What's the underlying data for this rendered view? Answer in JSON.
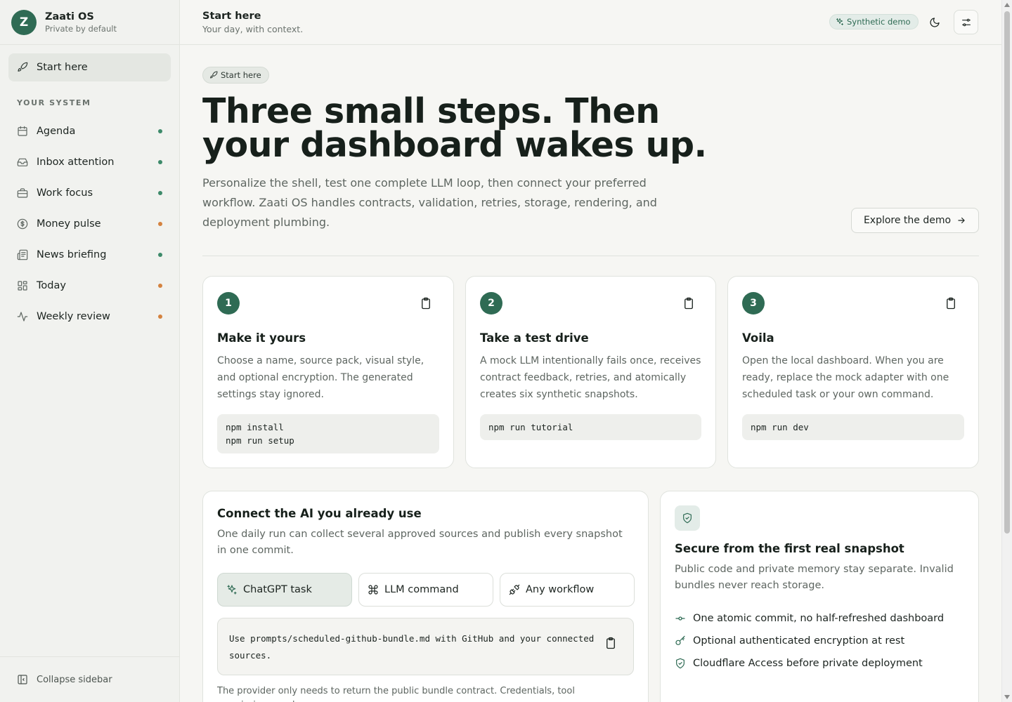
{
  "brand": {
    "initial": "Z",
    "name": "Zaati OS",
    "subtitle": "Private by default"
  },
  "sidebar": {
    "start": {
      "label": "Start here",
      "icon": "rocket-icon"
    },
    "section_label": "YOUR SYSTEM",
    "items": [
      {
        "label": "Agenda",
        "icon": "calendar-icon",
        "status_color": "#3d8a6a"
      },
      {
        "label": "Inbox attention",
        "icon": "inbox-icon",
        "status_color": "#3d8a6a"
      },
      {
        "label": "Work focus",
        "icon": "briefcase-icon",
        "status_color": "#3d8a6a"
      },
      {
        "label": "Money pulse",
        "icon": "dollar-circle-icon",
        "status_color": "#d4823f"
      },
      {
        "label": "News briefing",
        "icon": "newspaper-icon",
        "status_color": "#3d8a6a"
      },
      {
        "label": "Today",
        "icon": "grid-icon",
        "status_color": "#d4823f"
      },
      {
        "label": "Weekly review",
        "icon": "activity-icon",
        "status_color": "#d4823f"
      }
    ],
    "collapse_label": "Collapse sidebar"
  },
  "topbar": {
    "title": "Start here",
    "subtitle": "Your day, with context.",
    "demo_badge": "Synthetic demo"
  },
  "hero": {
    "badge": "Start here",
    "title": "Three small steps. Then your dashboard wakes up.",
    "description": "Personalize the shell, test one complete LLM loop, then connect your preferred workflow. Zaati OS handles contracts, validation, retries, storage, rendering, and deployment plumbing.",
    "explore_label": "Explore the demo"
  },
  "steps": [
    {
      "number": "1",
      "title": "Make it yours",
      "description": "Choose a name, source pack, visual style, and optional encryption. The generated settings stay ignored.",
      "code": [
        "npm install",
        "npm run setup"
      ]
    },
    {
      "number": "2",
      "title": "Take a test drive",
      "description": "A mock LLM intentionally fails once, receives contract feedback, retries, and atomically creates six synthetic snapshots.",
      "code": [
        "npm run tutorial"
      ]
    },
    {
      "number": "3",
      "title": "Voila",
      "description": "Open the local dashboard. When you are ready, replace the mock adapter with one scheduled task or your own command.",
      "code": [
        "npm run dev"
      ]
    }
  ],
  "connect": {
    "title": "Connect the AI you already use",
    "description": "One daily run can collect several approved sources and publish every snapshot in one commit.",
    "tabs": [
      {
        "label": "ChatGPT task",
        "icon": "sparkles-icon",
        "active": true
      },
      {
        "label": "LLM command",
        "icon": "command-icon",
        "active": false
      },
      {
        "label": "Any workflow",
        "icon": "plug-icon",
        "active": false
      }
    ],
    "prompt": "Use prompts/scheduled-github-bundle.md with GitHub and your connected sources.",
    "footnote": "The provider only needs to return the public bundle contract. Credentials, tool permissions, and"
  },
  "secure": {
    "title": "Secure from the first real snapshot",
    "description": "Public code and private memory stay separate. Invalid bundles never reach storage.",
    "items": [
      {
        "label": "One atomic commit, no half-refreshed dashboard",
        "icon": "commit-icon"
      },
      {
        "label": "Optional authenticated encryption at rest",
        "icon": "key-icon"
      },
      {
        "label": "Cloudflare Access before private deployment",
        "icon": "shield-check-icon"
      }
    ]
  },
  "colors": {
    "accent": "#2f6b54",
    "ok": "#3d8a6a",
    "warn": "#d4823f"
  }
}
